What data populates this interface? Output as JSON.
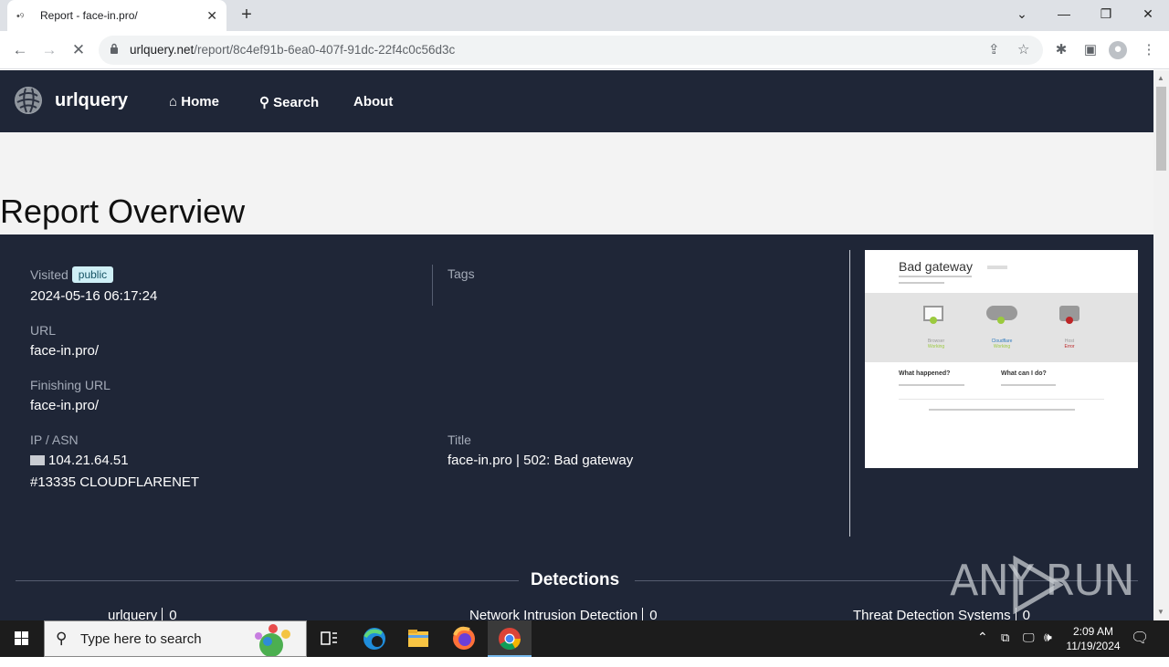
{
  "browser": {
    "tab_title": "Report - face-in.pro/",
    "url_host": "urlquery.net",
    "url_path": "/report/8c4ef91b-6ea0-407f-91dc-22f4c0c56d3c"
  },
  "navbar": {
    "brand": "urlquery",
    "links": [
      "Home",
      "Search",
      "About"
    ]
  },
  "page_title": "Report Overview",
  "report": {
    "visited_label": "Visited",
    "visibility_badge": "public",
    "visited_value": "2024-05-16 06:17:24",
    "tags_label": "Tags",
    "url_label": "URL",
    "url_value": "face-in.pro/",
    "finishing_url_label": "Finishing URL",
    "finishing_url_value": "face-in.pro/",
    "ip_label": "IP / ASN",
    "ip_value": "104.21.64.51",
    "asn_value": "#13335 CLOUDFLARENET",
    "title_label": "Title",
    "title_value": "face-in.pro | 502: Bad gateway"
  },
  "screenshot": {
    "heading": "Bad gateway",
    "status_a": "Browser",
    "status_a_state": "Working",
    "status_b": "Cloudflare",
    "status_b_state": "Working",
    "status_c": "Host",
    "status_c_state": "Error",
    "q1": "What happened?",
    "q2": "What can I do?"
  },
  "detections": {
    "heading": "Detections",
    "items": [
      {
        "name": "urlquery",
        "count": "0"
      },
      {
        "name": "Network Intrusion Detection",
        "count": "0"
      },
      {
        "name": "Threat Detection Systems",
        "count": "0"
      }
    ]
  },
  "watermark": "ANY RUN",
  "taskbar": {
    "search_placeholder": "Type here to search",
    "time": "2:09 AM",
    "date": "11/19/2024"
  }
}
